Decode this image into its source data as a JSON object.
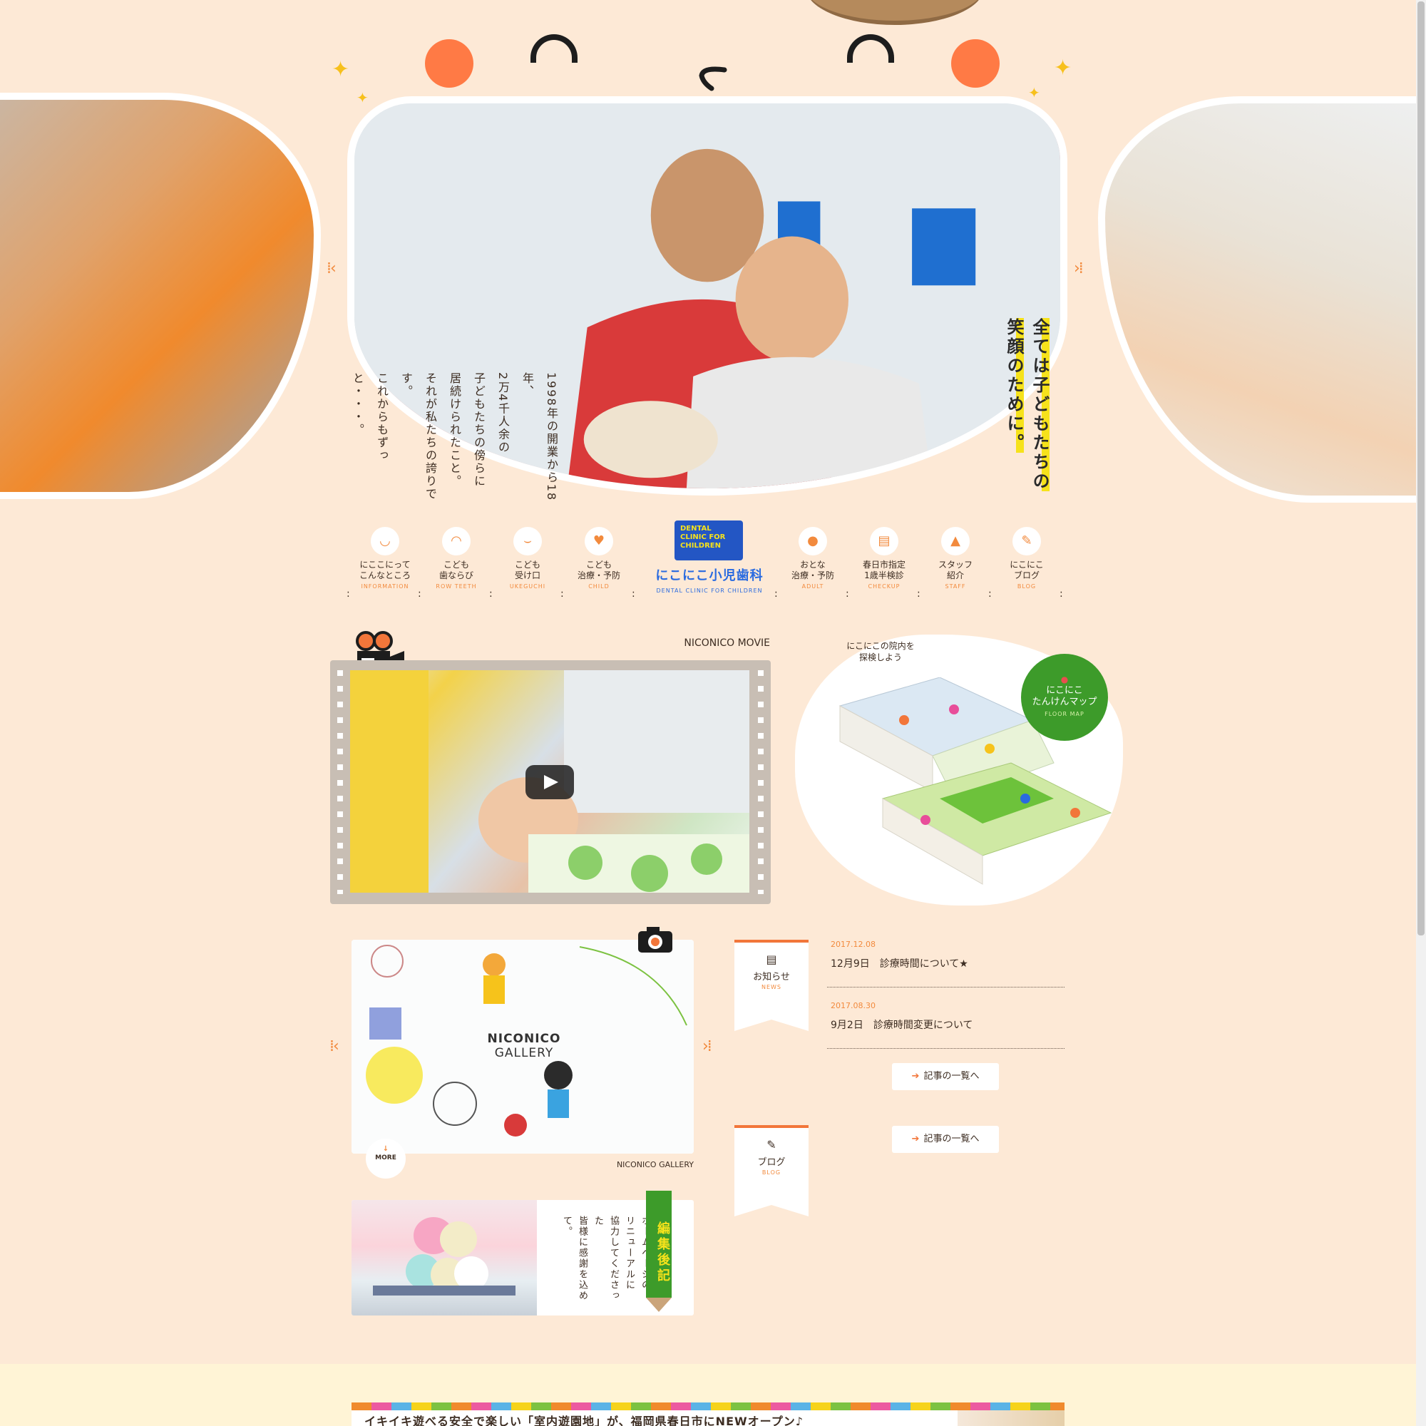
{
  "brand": {
    "logo_box_text": "DENTAL CLINIC FOR CHILDREN",
    "name_jp": "にこにこ小児歯科",
    "name_en": "DENTAL CLINIC FOR CHILDREN"
  },
  "hero": {
    "intro_lines": [
      "1998年の開業から18年、",
      "2万4千人余の",
      "子どもたちの傍らに",
      "居続けられたこと。",
      "それが私たちの誇りです。",
      "これからもずっと・・・。"
    ],
    "tagline_lines": [
      "全ては子どもたちの",
      "笑顔のために。"
    ]
  },
  "nav": {
    "items": [
      {
        "jp1": "にここにって",
        "jp2": "こんなところ",
        "en": "INFORMATION",
        "icon": "smile-icon"
      },
      {
        "jp1": "こども",
        "jp2": "歯ならび",
        "en": "ROW TEETH",
        "icon": "teeth-icon"
      },
      {
        "jp1": "こども",
        "jp2": "受け口",
        "en": "UKEGUCHI",
        "icon": "mouth-icon"
      },
      {
        "jp1": "こども",
        "jp2": "治療・予防",
        "en": "CHILD",
        "icon": "tooth-icon"
      },
      {
        "jp1": "おとな",
        "jp2": "治療・予防",
        "en": "ADULT",
        "icon": "person-icon"
      },
      {
        "jp1": "春日市指定",
        "jp2": "1歳半検診",
        "en": "CHECKUP",
        "icon": "clipboard-icon"
      },
      {
        "jp1": "スタッフ",
        "jp2": "紹介",
        "en": "STAFF",
        "icon": "bell-icon"
      },
      {
        "jp1": "にこにこ",
        "jp2": "ブログ",
        "en": "BLOG",
        "icon": "pencil-icon"
      }
    ]
  },
  "movie": {
    "label": "NICONICO MOVIE"
  },
  "map": {
    "bubble": "にこにこの院内を\n探検しよう",
    "circle_title": "にこにこ\nたんけんマップ",
    "circle_en": "FLOOR MAP"
  },
  "gallery": {
    "title_line1": "NICONICO",
    "title_line2": "GALLERY",
    "caption": "NICONICO GALLERY",
    "more": "MORE"
  },
  "editor": {
    "pencil_label": "編集後記",
    "lines": [
      "ホームページの",
      "リニューアルに",
      "協力してくださった",
      "皆様に感謝を込めて。"
    ]
  },
  "news": {
    "tag_jp": "お知らせ",
    "tag_en": "NEWS",
    "items": [
      {
        "date": "2017.12.08",
        "title": "12月9日　診療時間について★"
      },
      {
        "date": "2017.08.30",
        "title": "9月2日　診療時間変更について"
      }
    ],
    "more_label": "記事の一覧へ"
  },
  "blog": {
    "tag_jp": "ブログ",
    "tag_en": "BLOG",
    "more_label": "記事の一覧へ"
  },
  "banner": {
    "text": "イキイキ遊べる安全で楽しい「室内遊園地」が、福岡県春日市にNEWオープン♪"
  },
  "colors": {
    "background": "#fde9d6",
    "accent": "#f28a3d",
    "brand_blue": "#2356c4",
    "green": "#3d9b2a",
    "highlight": "#f6e21b"
  }
}
